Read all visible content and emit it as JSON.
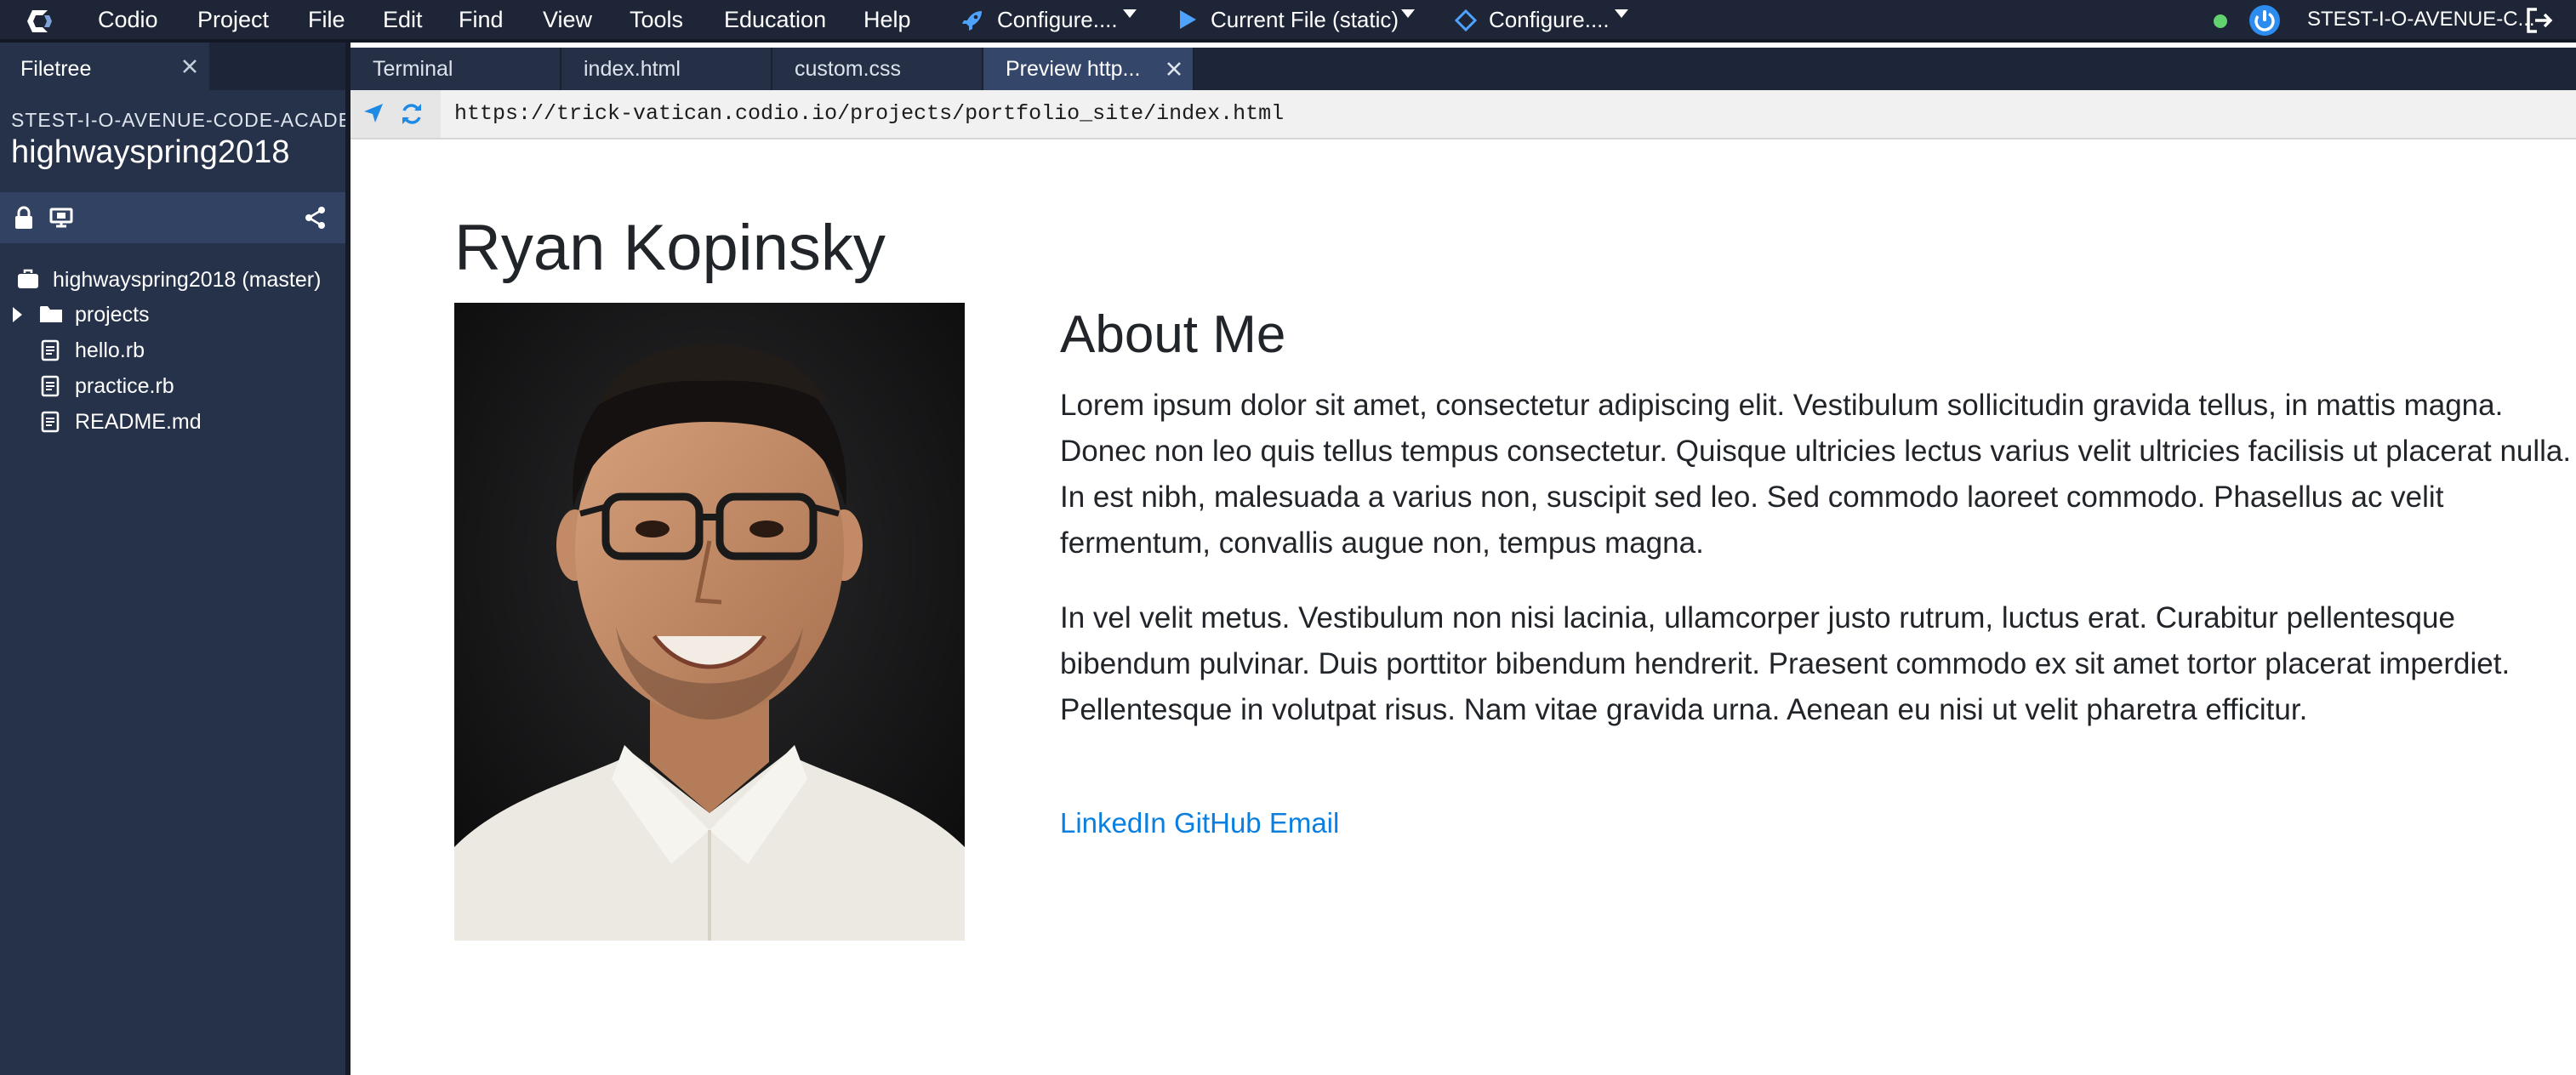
{
  "app": {
    "menu": [
      "Codio",
      "Project",
      "File",
      "Edit",
      "Find",
      "View",
      "Tools",
      "Education",
      "Help"
    ],
    "run_menu": {
      "configure_1": "Configure....",
      "current_file": "Current File (static)",
      "configure_2": "Configure...."
    },
    "box_name": "STEST-I-O-AVENUE-C...",
    "colors": {
      "menubar": "#1d2536",
      "sidebar": "#26324a",
      "active_tab": "#34466a",
      "link": "#0b7fe0",
      "status": "#62d26f"
    }
  },
  "filetree": {
    "tab_label": "Filetree",
    "org": "STEST-I-O-AVENUE-CODE-ACADEMY",
    "project": "highwayspring2018",
    "items": [
      {
        "label": "highwayspring2018 (master)",
        "icon": "briefcase-icon"
      },
      {
        "label": "projects",
        "icon": "folder-icon"
      },
      {
        "label": "hello.rb",
        "icon": "file-icon"
      },
      {
        "label": "practice.rb",
        "icon": "file-icon"
      },
      {
        "label": "README.md",
        "icon": "file-icon"
      }
    ]
  },
  "tabs": [
    {
      "label": "Terminal"
    },
    {
      "label": "index.html"
    },
    {
      "label": "custom.css"
    },
    {
      "label": "Preview http...",
      "active": true
    }
  ],
  "preview": {
    "url": "https://trick-vatican.codio.io/projects/portfolio_site/index.html",
    "name": "Ryan Kopinsky",
    "about_title": "About Me",
    "paragraphs": [
      "Lorem ipsum dolor sit amet, consectetur adipiscing elit. Vestibulum sollicitudin gravida tellus, in mattis magna. Donec non leo quis tellus tempus consectetur. Quisque ultricies lectus varius velit ultricies facilisis ut placerat nulla. In est nibh, malesuada a varius non, suscipit sed leo. Sed commodo laoreet commodo. Phasellus ac velit fermentum, convallis augue non, tempus magna.",
      "In vel velit metus. Vestibulum non nisi lacinia, ullamcorper justo rutrum, luctus erat. Curabitur pellentesque bibendum pulvinar. Duis porttitor bibendum hendrerit. Praesent commodo ex sit amet tortor placerat imperdiet. Pellentesque in volutpat risus. Nam vitae gravida urna. Aenean eu nisi ut velit pharetra efficitur."
    ],
    "links": [
      "LinkedIn",
      "GitHub",
      "Email"
    ]
  }
}
